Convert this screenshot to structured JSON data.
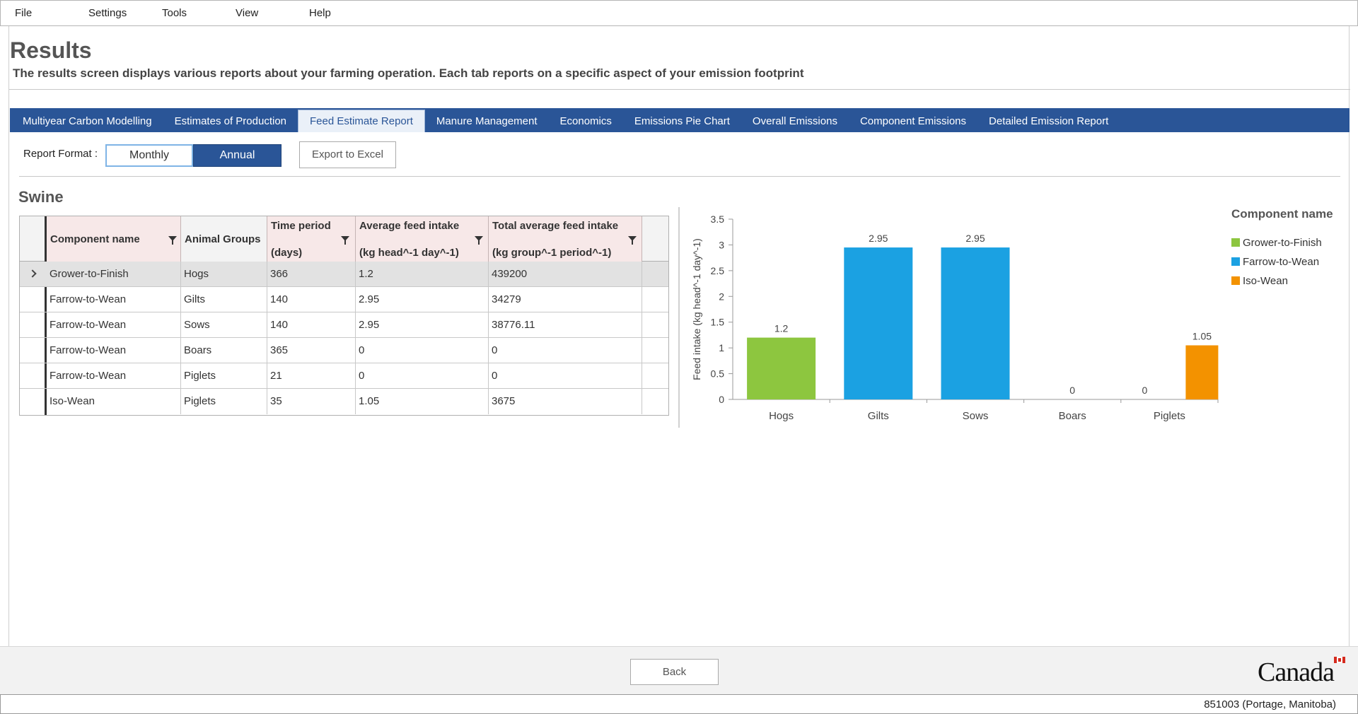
{
  "menu": [
    "File",
    "Settings",
    "Tools",
    "View",
    "Help"
  ],
  "page": {
    "title": "Results",
    "subtitle": "The results screen displays various reports about your farming operation. Each tab reports on a specific aspect of your emission footprint"
  },
  "tabs": [
    {
      "label": "Multiyear Carbon Modelling",
      "active": false
    },
    {
      "label": "Estimates of Production",
      "active": false
    },
    {
      "label": "Feed Estimate Report",
      "active": true
    },
    {
      "label": "Manure Management",
      "active": false
    },
    {
      "label": "Economics",
      "active": false
    },
    {
      "label": "Emissions Pie Chart",
      "active": false
    },
    {
      "label": "Overall Emissions",
      "active": false
    },
    {
      "label": "Component Emissions",
      "active": false
    },
    {
      "label": "Detailed Emission Report",
      "active": false
    }
  ],
  "report_format": {
    "label": "Report Format :",
    "monthly": "Monthly",
    "annual": "Annual",
    "selected": "Annual",
    "export": "Export to Excel"
  },
  "section_title": "Swine",
  "grid": {
    "headers": {
      "component": "Component name",
      "groups": "Animal Groups",
      "time_l1": "Time period",
      "time_l2": "(days)",
      "avg_l1": "Average feed intake",
      "avg_l2": "(kg head^-1 day^-1)",
      "total_l1": "Total average feed intake",
      "total_l2": "(kg group^-1 period^-1)"
    },
    "rows": [
      {
        "component": "Grower-to-Finish",
        "group": "Hogs",
        "days": "366",
        "avg": "1.2",
        "total": "439200"
      },
      {
        "component": "Farrow-to-Wean",
        "group": "Gilts",
        "days": "140",
        "avg": "2.95",
        "total": "34279"
      },
      {
        "component": "Farrow-to-Wean",
        "group": "Sows",
        "days": "140",
        "avg": "2.95",
        "total": "38776.11"
      },
      {
        "component": "Farrow-to-Wean",
        "group": "Boars",
        "days": "365",
        "avg": "0",
        "total": "0"
      },
      {
        "component": "Farrow-to-Wean",
        "group": "Piglets",
        "days": "21",
        "avg": "0",
        "total": "0"
      },
      {
        "component": "Iso-Wean",
        "group": "Piglets",
        "days": "35",
        "avg": "1.05",
        "total": "3675"
      }
    ]
  },
  "chart_data": {
    "type": "bar",
    "categories": [
      "Hogs",
      "Gilts",
      "Sows",
      "Boars",
      "Piglets"
    ],
    "ylabel": "Feed intake (kg head^-1 day^-1)",
    "ylim": [
      0,
      3.5
    ],
    "yticks": [
      "0",
      "0.5",
      "1",
      "1.5",
      "2",
      "2.5",
      "3",
      "3.5"
    ],
    "legend_title": "Component name",
    "legend_position": "right",
    "series": [
      {
        "name": "Grower-to-Finish",
        "color": "#8dc63f",
        "values": [
          1.2,
          null,
          null,
          null,
          null
        ]
      },
      {
        "name": "Farrow-to-Wean",
        "color": "#1ba1e2",
        "values": [
          null,
          2.95,
          2.95,
          0,
          0
        ]
      },
      {
        "name": "Iso-Wean",
        "color": "#f39200",
        "values": [
          null,
          null,
          null,
          null,
          1.05
        ]
      }
    ],
    "bar_labels": [
      {
        "category": "Hogs",
        "series": "Grower-to-Finish",
        "label": "1.2"
      },
      {
        "category": "Gilts",
        "series": "Farrow-to-Wean",
        "label": "2.95"
      },
      {
        "category": "Sows",
        "series": "Farrow-to-Wean",
        "label": "2.95"
      },
      {
        "category": "Boars",
        "series": "Farrow-to-Wean",
        "label": "0"
      },
      {
        "category": "Piglets",
        "series": "Farrow-to-Wean",
        "label": "0"
      },
      {
        "category": "Piglets",
        "series": "Iso-Wean",
        "label": "1.05"
      }
    ]
  },
  "footer": {
    "back": "Back",
    "logo": "Canada"
  },
  "status": "851003 (Portage, Manitoba)"
}
